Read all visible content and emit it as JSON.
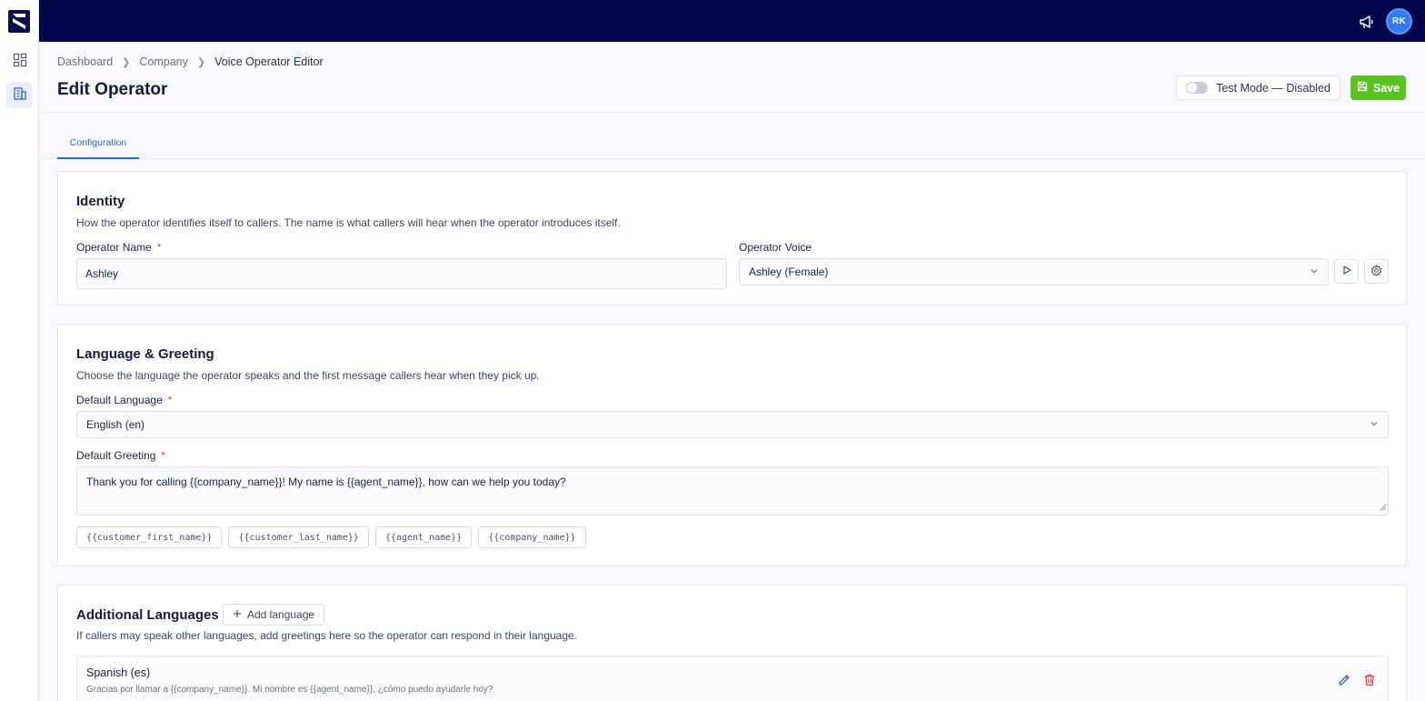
{
  "topbar": {
    "avatar_initials": "RK"
  },
  "breadcrumb": {
    "items": [
      "Dashboard",
      "Company"
    ],
    "current": "Voice Operator Editor"
  },
  "header": {
    "title": "Edit Operator",
    "test_mode_label": "Test Mode — Disabled",
    "test_mode_enabled": false,
    "save_label": "Save"
  },
  "tabs": [
    {
      "label": "Configuration",
      "active": true
    }
  ],
  "identity": {
    "title": "Identity",
    "description": "How the operator identifies itself to callers. The name is what callers will hear when the operator introduces itself.",
    "name_label": "Operator Name",
    "name_value": "Ashley",
    "voice_label": "Operator Voice",
    "voice_value": "Ashley (Female)"
  },
  "language": {
    "title": "Language & Greeting",
    "description": "Choose the language the operator speaks and the first message callers hear when they pick up.",
    "default_language_label": "Default Language",
    "default_language_value": "English (en)",
    "greeting_label": "Default Greeting",
    "greeting_value": "Thank you for calling {{company_name}}! My name is {{agent_name}}, how can we help you today?",
    "variables": [
      "{{customer_first_name}}",
      "{{customer_last_name}}",
      "{{agent_name}}",
      "{{company_name}}"
    ]
  },
  "additional": {
    "title": "Additional Languages",
    "add_label": "Add language",
    "description": "If callers may speak other languages, add greetings here so the operator can respond in their language.",
    "languages": [
      {
        "name": "Spanish (es)",
        "greeting": "Gracias por llamar a {{company_name}}. Mi nombre es {{agent_name}}, ¿cómo puedo ayudarle hoy?"
      }
    ]
  },
  "colors": {
    "topbar": "#02064a",
    "accent": "#2d6bcf",
    "save": "#58c41e",
    "delete": "#e0453f",
    "required": "#e0453f"
  },
  "icons": {
    "logo": "brand-logo",
    "dashboard": "grid-icon",
    "company": "building-icon",
    "announce": "megaphone-icon",
    "save": "floppy-icon",
    "play": "play-icon",
    "settings": "gear-icon",
    "dropdown": "chevron-down-icon",
    "add": "plus-icon",
    "edit": "pencil-icon",
    "delete": "trash-icon"
  }
}
